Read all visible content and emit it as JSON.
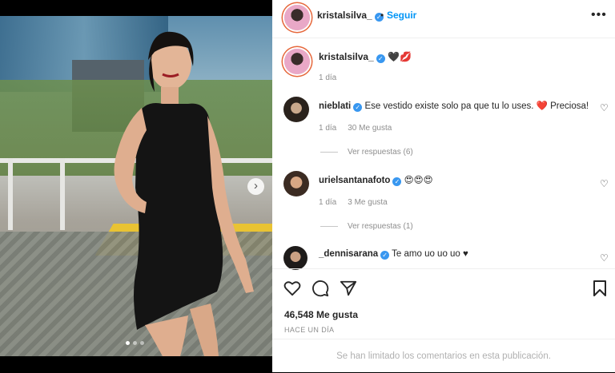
{
  "header": {
    "username": "kristalsilva_",
    "separator": "•",
    "follow_label": "Seguir",
    "more_label": "•••"
  },
  "caption": {
    "username": "kristalsilva_",
    "emojis": "🖤💋",
    "time": "1 día"
  },
  "comments": [
    {
      "username": "nieblati",
      "verified": true,
      "text": "Ese vestido existe solo pa que tu lo uses. ❤️ Preciosa!",
      "time": "1 día",
      "likes": "30 Me gusta",
      "replies": "Ver respuestas (6)"
    },
    {
      "username": "urielsantanafoto",
      "verified": true,
      "text": "😍😍😍",
      "time": "1 día",
      "likes": "3 Me gusta",
      "replies": "Ver respuestas (1)"
    },
    {
      "username": "_dennisarana",
      "verified": true,
      "text": "Te amo uo uo uo ♥"
    }
  ],
  "post": {
    "likes": "46,548 Me gusta",
    "date": "HACE UN DÍA",
    "comments_limited": "Se han limitado los comentarios en esta publicación."
  },
  "icons": {
    "verified": "✓",
    "heart_small": "♡",
    "carousel_next": "›"
  },
  "carousel": {
    "total": 3,
    "current": 1
  },
  "colors": {
    "accent": "#0095f6",
    "verified": "#3897f0",
    "muted": "#8e8e8e"
  }
}
